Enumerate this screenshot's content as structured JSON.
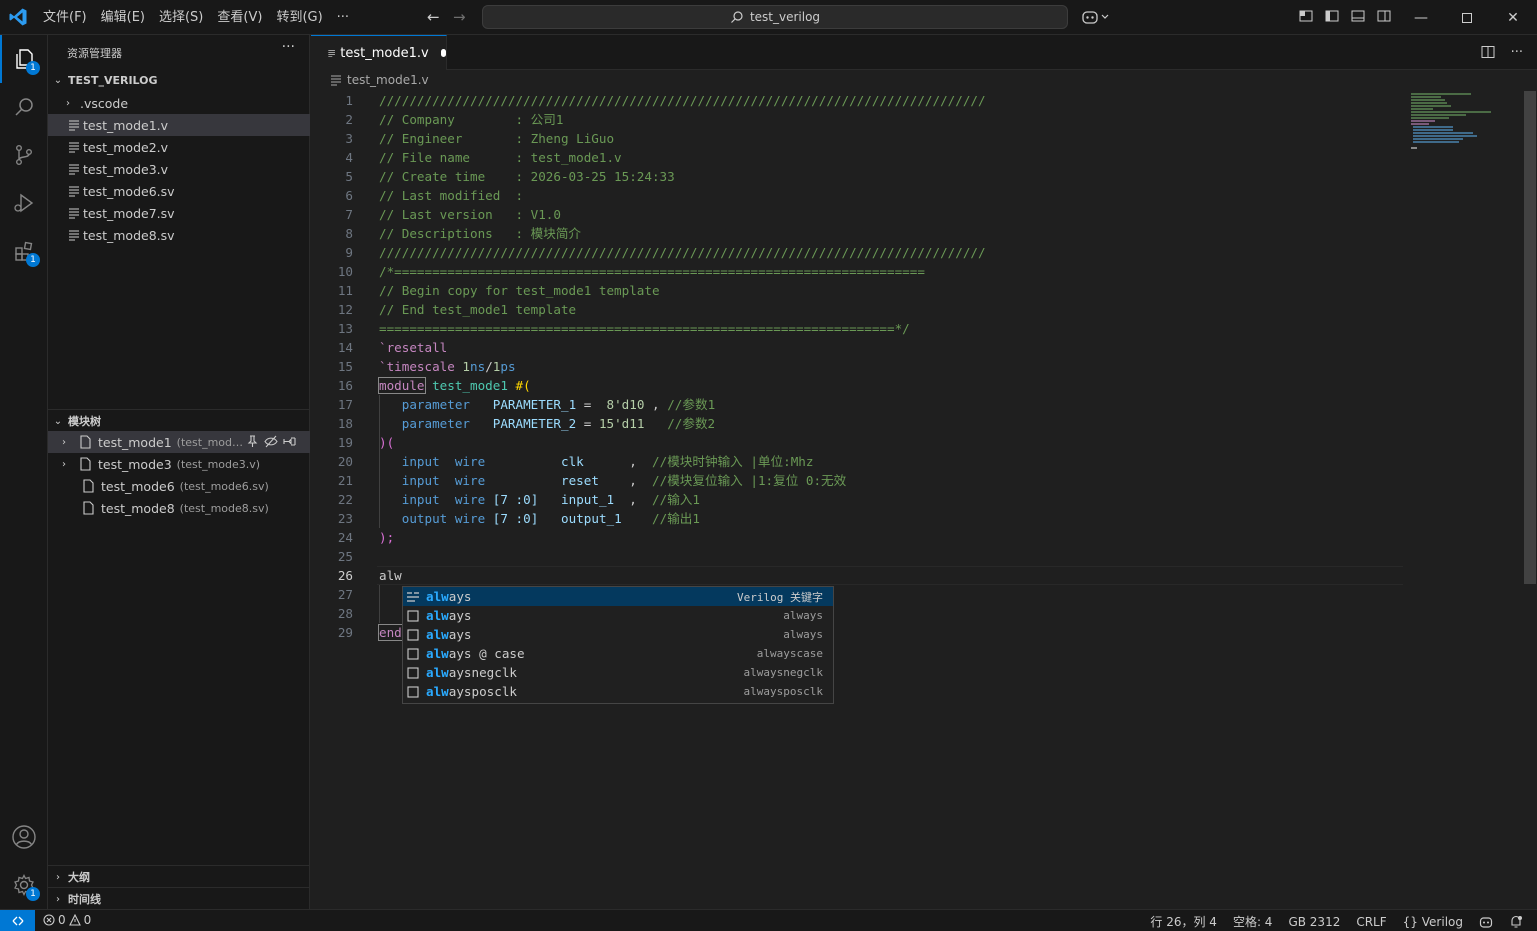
{
  "titlebar": {
    "menu": [
      "文件(F)",
      "编辑(E)",
      "选择(S)",
      "查看(V)",
      "转到(G)",
      "···"
    ],
    "search_text": "test_verilog"
  },
  "sidebar": {
    "title": "资源管理器",
    "more": "···",
    "root_label": "TEST_VERILOG",
    "files": [
      ".vscode",
      "test_mode1.v",
      "test_mode2.v",
      "test_mode3.v",
      "test_mode6.sv",
      "test_mode7.sv",
      "test_mode8.sv"
    ],
    "module_tree": {
      "title": "模块树",
      "items": [
        {
          "name": "test_mode1",
          "desc": "(test_mod…"
        },
        {
          "name": "test_mode3",
          "desc": "(test_mode3.v)"
        },
        {
          "name": "test_mode6",
          "desc": "(test_mode6.sv)"
        },
        {
          "name": "test_mode8",
          "desc": "(test_mode8.sv)"
        }
      ]
    },
    "outline_label": "大纲",
    "timeline_label": "时间线"
  },
  "activity_badges": {
    "explorer": "1",
    "extensions": "1",
    "settings": "1"
  },
  "editor": {
    "tab_label": "test_mode1.v",
    "breadcrumb": "test_mode1.v",
    "line_numbers": [
      "1",
      "2",
      "3",
      "4",
      "5",
      "6",
      "7",
      "8",
      "9",
      "10",
      "11",
      "12",
      "13",
      "14",
      "15",
      "16",
      "17",
      "18",
      "19",
      "20",
      "21",
      "22",
      "23",
      "24",
      "25",
      "26",
      "27",
      "28",
      "29"
    ],
    "lines": {
      "l1": "////////////////////////////////////////////////////////////////////////////////",
      "l2": "// Company        : 公司1",
      "l3": "// Engineer       : Zheng LiGuo",
      "l4": "// File name      : test_mode1.v",
      "l5": "// Create time    : 2026-03-25 15:24:33",
      "l6": "// Last modified  :",
      "l7": "// Last version   : V1.0",
      "l8": "// Descriptions   : 模块简介",
      "l9": "////////////////////////////////////////////////////////////////////////////////",
      "l10": "/*======================================================================",
      "l11": "// Begin copy for test_mode1 template",
      "l12": "// End test_mode1 template",
      "l13": "====================================================================*/",
      "l14_kw": "`resetall",
      "l15_kw": "`timescale",
      "l15_a": "1",
      "l15_b": "ns",
      "l15_c": "/",
      "l15_d": "1",
      "l15_e": "ps",
      "l16_kw": "module",
      "l16_name": "test_mode1",
      "l16_rest": "#(",
      "l17_kw": "parameter",
      "l17_id": "PARAMETER_1",
      "l17_eq": "=",
      "l17_num": "8'd10",
      "l17_sep": ",",
      "l17_com": "//参数1",
      "l18_kw": "parameter",
      "l18_id": "PARAMETER_2",
      "l18_eq": "=",
      "l18_num": "15'd11",
      "l18_com": "//参数2",
      "l19": ")(",
      "l20_dir": "input",
      "l20_type": "wire",
      "l20_id": "clk",
      "l20_sep": ",",
      "l20_com": "//模块时钟输入 |单位:Mhz",
      "l21_dir": "input",
      "l21_type": "wire",
      "l21_id": "reset",
      "l21_sep": ",",
      "l21_com": "//模块复位输入 |1:复位 0:无效",
      "l22_dir": "input",
      "l22_type": "wire",
      "l22_range": "[7 :0]",
      "l22_id": "input_1",
      "l22_sep": ",",
      "l22_com": "//输入1",
      "l23_dir": "output",
      "l23_type": "wire",
      "l23_range": "[7 :0]",
      "l23_id": "output_1",
      "l23_com": "//输出1",
      "l24": ");",
      "l26": "alw",
      "l29": "end"
    }
  },
  "suggest": [
    {
      "match": "alw",
      "rest": "ays",
      "detail": "Verilog 关键字",
      "kind": "keyword"
    },
    {
      "match": "alw",
      "rest": "ays",
      "detail": "always",
      "kind": "snippet"
    },
    {
      "match": "alw",
      "rest": "ays",
      "detail": "always",
      "kind": "snippet"
    },
    {
      "match": "alw",
      "rest": "ays @ case",
      "detail": "alwayscase",
      "kind": "snippet"
    },
    {
      "match": "alw",
      "rest": "aysnegclk",
      "detail": "alwaysnegclk",
      "kind": "snippet"
    },
    {
      "match": "alw",
      "rest": "aysposclk",
      "detail": "alwaysposclk",
      "kind": "snippet"
    }
  ],
  "statusbar": {
    "errors": "0",
    "warnings": "0",
    "position": "行 26，列 4",
    "spaces": "空格: 4",
    "encoding": "GB 2312",
    "eol": "CRLF",
    "language": "Verilog"
  },
  "colors": {
    "accent": "#0078d4",
    "comment": "#6a9955",
    "keyword": "#569cd6",
    "directive": "#c586c0"
  }
}
